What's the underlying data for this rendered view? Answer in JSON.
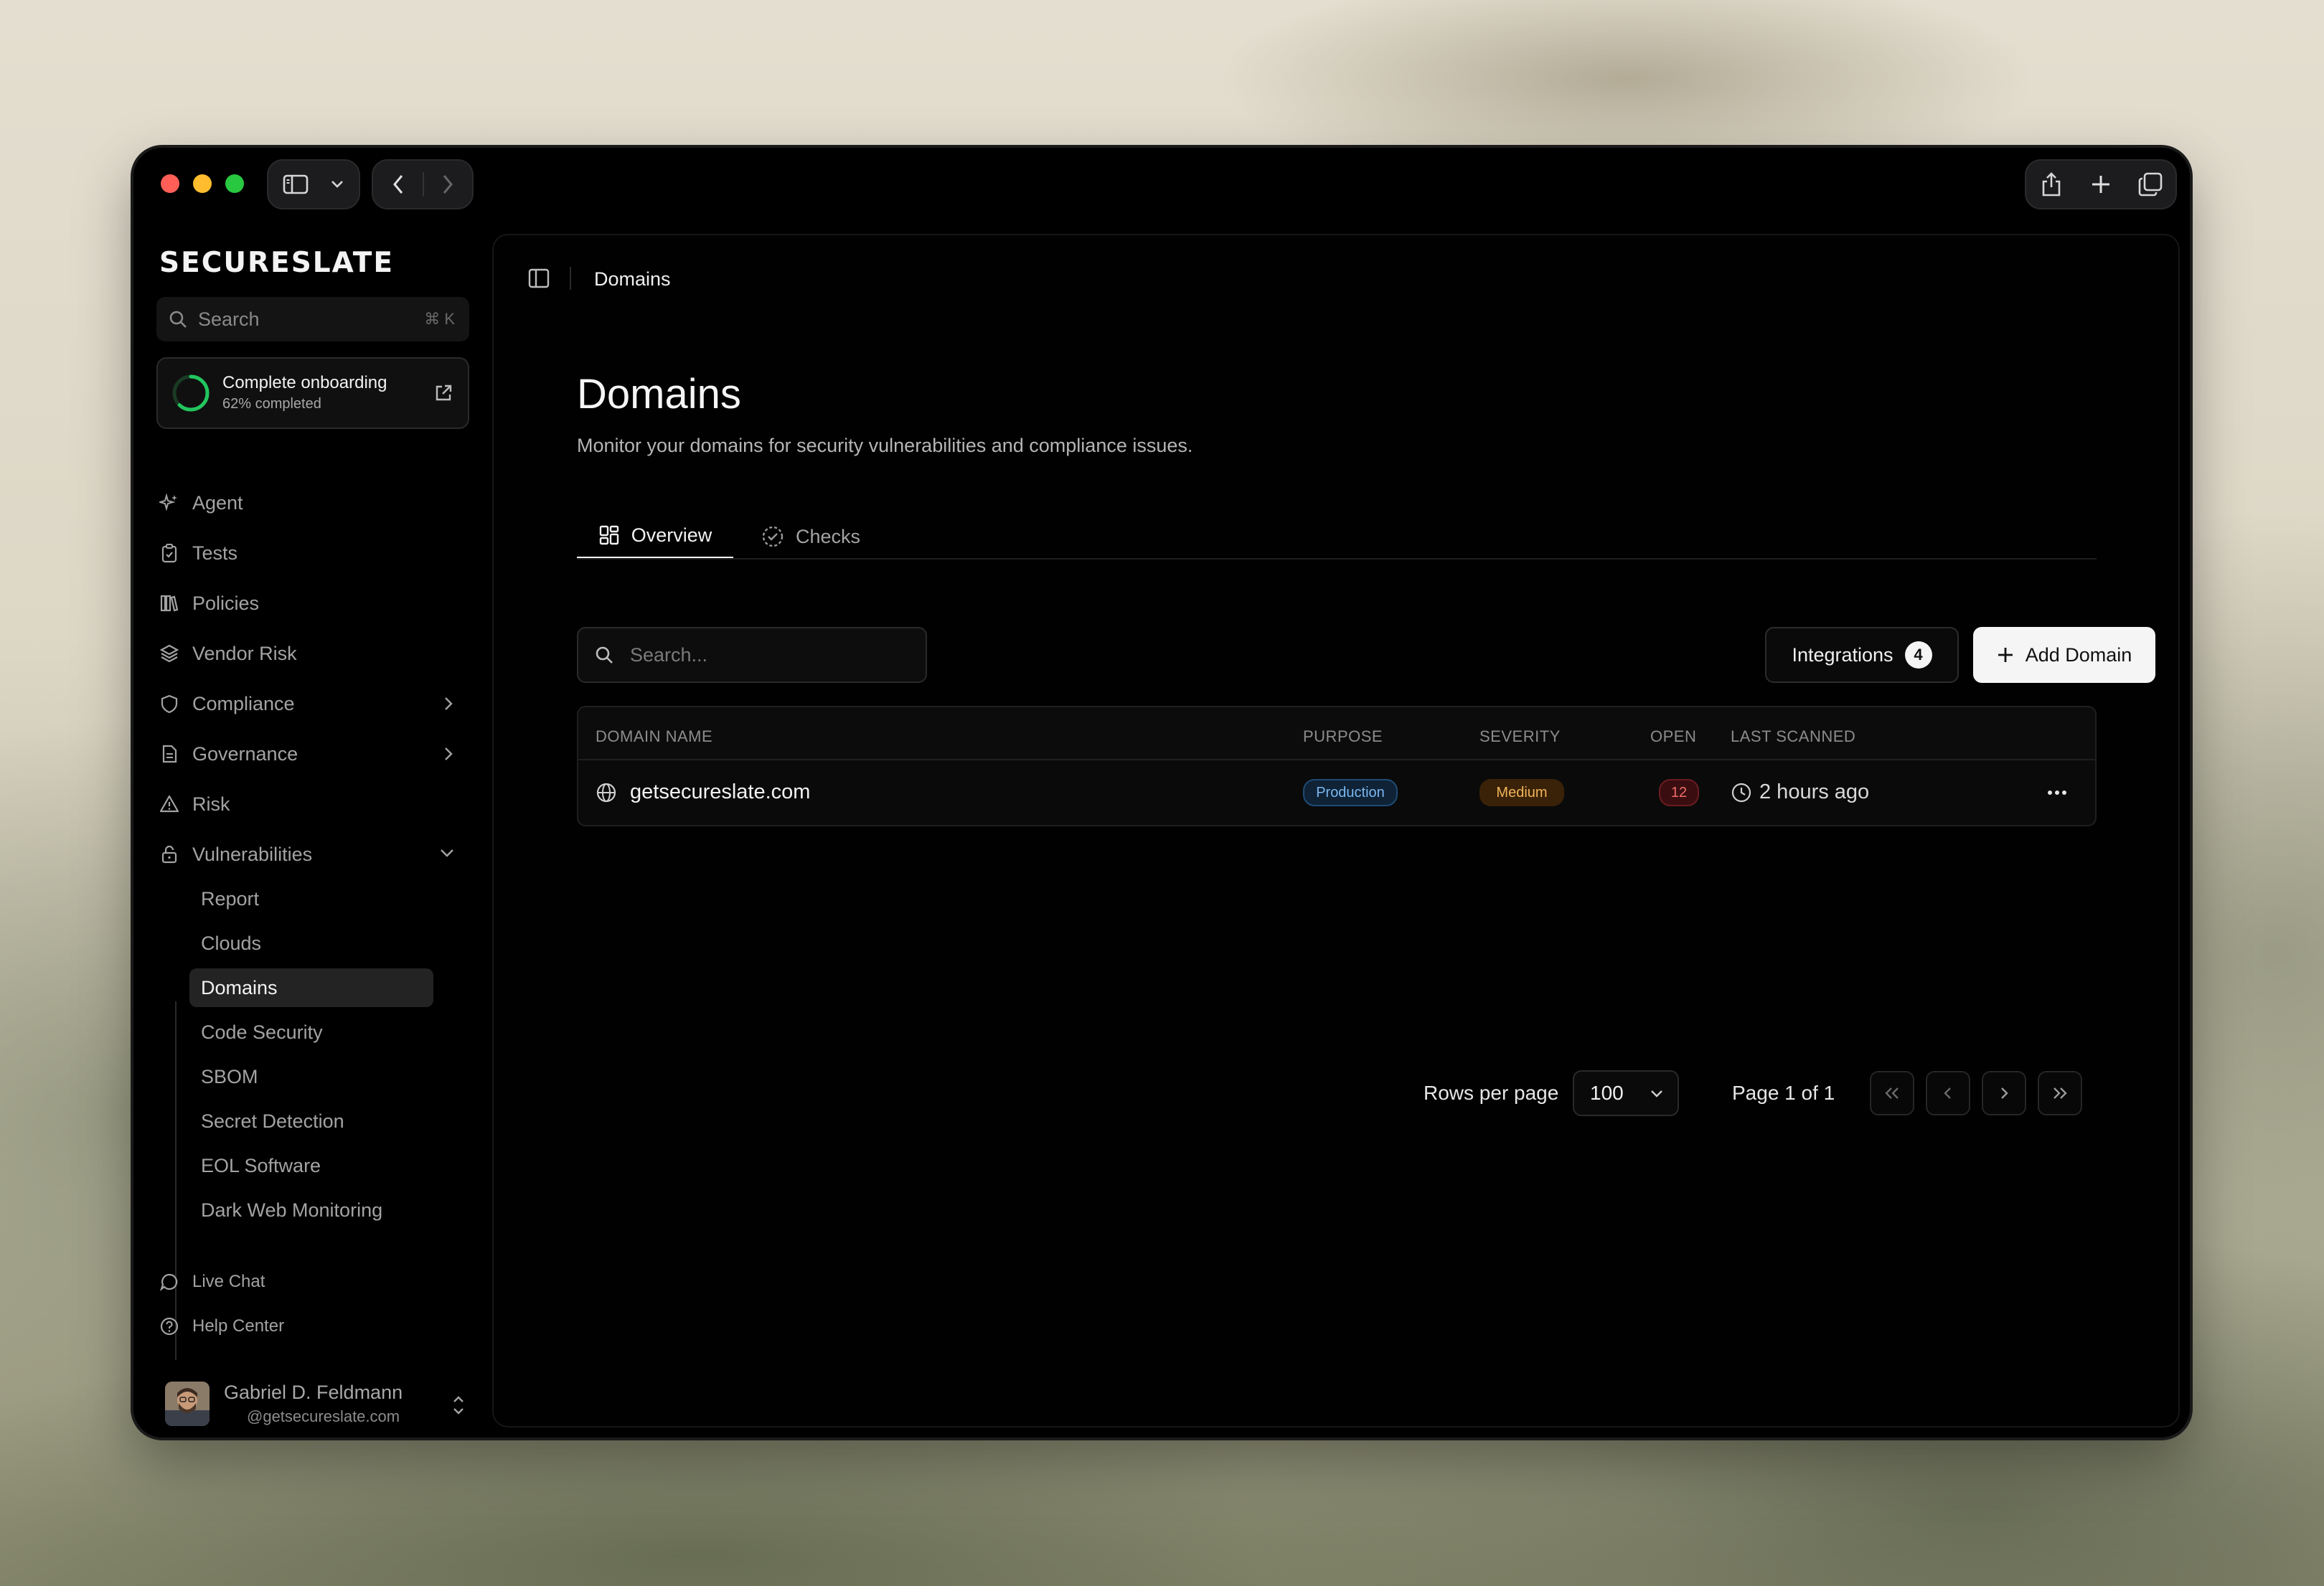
{
  "app": {
    "logo_text": "SECURESLATE",
    "search_placeholder": "Search",
    "search_shortcut": "⌘ K"
  },
  "onboarding": {
    "title": "Complete onboarding",
    "progress_text": "62% completed",
    "progress_fraction": 0.62,
    "ring_color": "#22c55e"
  },
  "sidebar": {
    "items": [
      {
        "label": "Agent",
        "icon": "sparkles-icon"
      },
      {
        "label": "Tests",
        "icon": "clipboard-check-icon"
      },
      {
        "label": "Policies",
        "icon": "library-icon"
      },
      {
        "label": "Vendor Risk",
        "icon": "layers-icon"
      },
      {
        "label": "Compliance",
        "icon": "shield-icon"
      },
      {
        "label": "Governance",
        "icon": "file-text-icon"
      },
      {
        "label": "Risk",
        "icon": "alert-triangle-icon"
      },
      {
        "label": "Vulnerabilities",
        "icon": "lock-open-icon"
      }
    ],
    "vuln_sub": [
      {
        "label": "Report"
      },
      {
        "label": "Clouds"
      },
      {
        "label": "Domains"
      },
      {
        "label": "Code Security"
      },
      {
        "label": "SBOM"
      },
      {
        "label": "Secret Detection"
      },
      {
        "label": "EOL Software"
      },
      {
        "label": "Dark Web Monitoring"
      }
    ],
    "footer": [
      {
        "label": "Live Chat",
        "icon": "message-circle-icon"
      },
      {
        "label": "Help Center",
        "icon": "help-circle-icon"
      }
    ],
    "user": {
      "name": "Gabriel D. Feldmann",
      "handle": "@getsecureslate.com"
    }
  },
  "header": {
    "breadcrumb": "Domains"
  },
  "page": {
    "title": "Domains",
    "subtitle": "Monitor your domains for security vulnerabilities and compliance issues.",
    "tabs": [
      {
        "label": "Overview",
        "icon": "layout-dashboard-icon",
        "active": true
      },
      {
        "label": "Checks",
        "icon": "circle-check-icon",
        "active": false
      }
    ]
  },
  "toolbar": {
    "search_placeholder": "Search...",
    "integrations_label": "Integrations",
    "integrations_count": "4",
    "add_label": "Add Domain"
  },
  "table": {
    "headers": {
      "domain": "DOMAIN NAME",
      "purpose": "PURPOSE",
      "severity": "SEVERITY",
      "open": "OPEN",
      "scanned": "LAST SCANNED"
    },
    "rows": [
      {
        "domain": "getsecureslate.com",
        "purpose": "Production",
        "severity": "Medium",
        "open": "12",
        "scanned": "2 hours ago"
      }
    ]
  },
  "pagination": {
    "rows_label": "Rows per page",
    "rows_value": "100",
    "page_text": "Page 1 of 1"
  },
  "colors": {
    "accent_green": "#22c55e",
    "production_badge": "#1e3a5f",
    "medium_badge": "#4a2a0a",
    "open_badge": "#4a1414"
  }
}
